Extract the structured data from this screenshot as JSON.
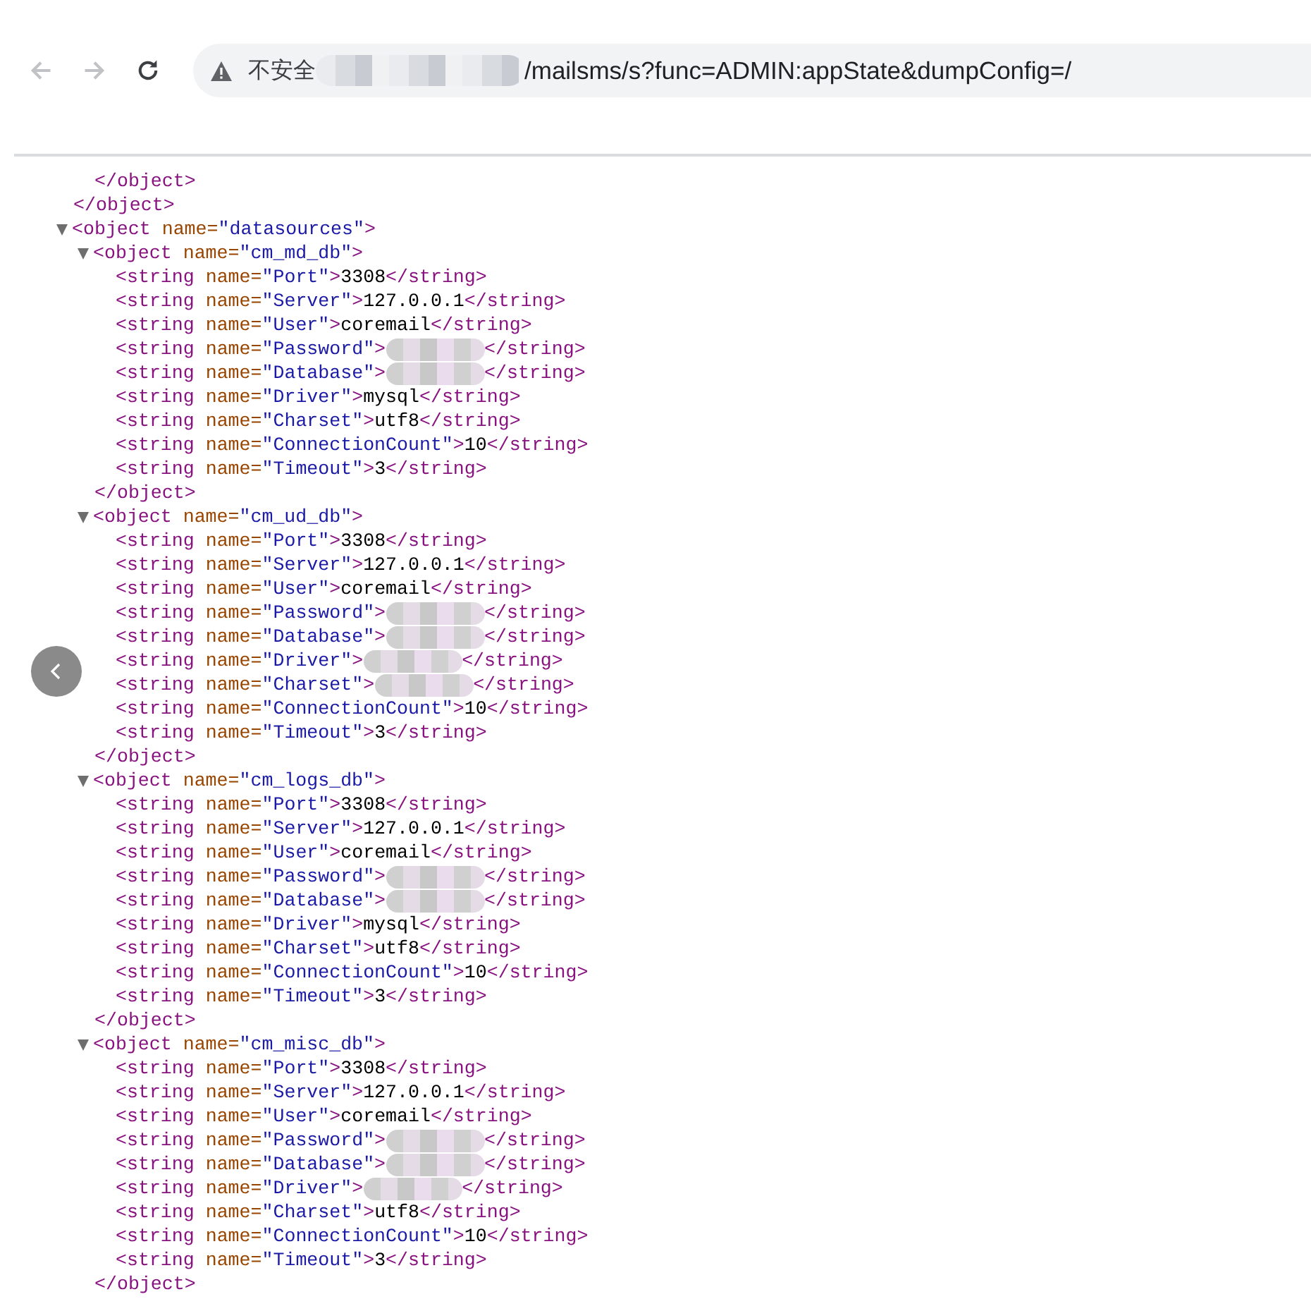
{
  "browser": {
    "nav": [
      {
        "kind": "back",
        "disabled": true
      },
      {
        "kind": "forward",
        "disabled": true
      },
      {
        "kind": "reload",
        "disabled": false
      }
    ],
    "security_label": "不安全",
    "url_parts": [
      {
        "kind": "redacted"
      },
      {
        "kind": "text",
        "text": "/mailsms/s?func=ADMIN:appState&dumpConfig=/"
      }
    ]
  },
  "xml": [
    {
      "kind": "tail",
      "close": "</object>",
      "children": [
        {
          "kind": "tail",
          "close": "</object>"
        }
      ]
    },
    {
      "kind": "element",
      "expanded": true,
      "open": "<object name=\"datasources\">",
      "children": [
        {
          "kind": "element",
          "expanded": true,
          "open": "<object name=\"cm_md_db\">",
          "close": "</object>",
          "children": [
            {
              "kind": "leaf",
              "open": "<string name=\"Port\">",
              "value": "3308",
              "close": "</string>",
              "redacted": false
            },
            {
              "kind": "leaf",
              "open": "<string name=\"Server\">",
              "value": "127.0.0.1",
              "close": "</string>",
              "redacted": false
            },
            {
              "kind": "leaf",
              "open": "<string name=\"User\">",
              "value": "coremail",
              "close": "</string>",
              "redacted": false
            },
            {
              "kind": "leaf",
              "open": "<string name=\"Password\">",
              "close": "</string>",
              "redacted": true
            },
            {
              "kind": "leaf",
              "open": "<string name=\"Database\">",
              "close": "</string>",
              "redacted": true
            },
            {
              "kind": "leaf",
              "open": "<string name=\"Driver\">",
              "value": "mysql",
              "close": "</string>",
              "redacted": false
            },
            {
              "kind": "leaf",
              "open": "<string name=\"Charset\">",
              "value": "utf8",
              "close": "</string>",
              "redacted": false
            },
            {
              "kind": "leaf",
              "open": "<string name=\"ConnectionCount\">",
              "value": "10",
              "close": "</string>",
              "redacted": false
            },
            {
              "kind": "leaf",
              "open": "<string name=\"Timeout\">",
              "value": "3",
              "close": "</string>",
              "redacted": false
            }
          ]
        },
        {
          "kind": "element",
          "expanded": true,
          "open": "<object name=\"cm_ud_db\">",
          "close": "</object>",
          "children": [
            {
              "kind": "leaf",
              "open": "<string name=\"Port\">",
              "value": "3308",
              "close": "</string>",
              "redacted": false
            },
            {
              "kind": "leaf",
              "open": "<string name=\"Server\">",
              "value": "127.0.0.1",
              "close": "</string>",
              "redacted": false
            },
            {
              "kind": "leaf",
              "open": "<string name=\"User\">",
              "value": "coremail",
              "close": "</string>",
              "redacted": false
            },
            {
              "kind": "leaf",
              "open": "<string name=\"Password\">",
              "close": "</string>",
              "redacted": true
            },
            {
              "kind": "leaf",
              "open": "<string name=\"Database\">",
              "close": "</string>",
              "redacted": true
            },
            {
              "kind": "leaf",
              "open": "<string name=\"Driver\">",
              "close": "</string>",
              "redacted": true
            },
            {
              "kind": "leaf",
              "open": "<string name=\"Charset\">",
              "close": "</string>",
              "redacted": true
            },
            {
              "kind": "leaf",
              "open": "<string name=\"ConnectionCount\">",
              "value": "10",
              "close": "</string>",
              "redacted": false
            },
            {
              "kind": "leaf",
              "open": "<string name=\"Timeout\">",
              "value": "3",
              "close": "</string>",
              "redacted": false
            }
          ]
        },
        {
          "kind": "element",
          "expanded": true,
          "open": "<object name=\"cm_logs_db\">",
          "close": "</object>",
          "children": [
            {
              "kind": "leaf",
              "open": "<string name=\"Port\">",
              "value": "3308",
              "close": "</string>",
              "redacted": false
            },
            {
              "kind": "leaf",
              "open": "<string name=\"Server\">",
              "value": "127.0.0.1",
              "close": "</string>",
              "redacted": false
            },
            {
              "kind": "leaf",
              "open": "<string name=\"User\">",
              "value": "coremail",
              "close": "</string>",
              "redacted": false
            },
            {
              "kind": "leaf",
              "open": "<string name=\"Password\">",
              "close": "</string>",
              "redacted": true
            },
            {
              "kind": "leaf",
              "open": "<string name=\"Database\">",
              "close": "</string>",
              "redacted": true
            },
            {
              "kind": "leaf",
              "open": "<string name=\"Driver\">",
              "value": "mysql",
              "close": "</string>",
              "redacted": false
            },
            {
              "kind": "leaf",
              "open": "<string name=\"Charset\">",
              "value": "utf8",
              "close": "</string>",
              "redacted": false
            },
            {
              "kind": "leaf",
              "open": "<string name=\"ConnectionCount\">",
              "value": "10",
              "close": "</string>",
              "redacted": false
            },
            {
              "kind": "leaf",
              "open": "<string name=\"Timeout\">",
              "value": "3",
              "close": "</string>",
              "redacted": false
            }
          ]
        },
        {
          "kind": "element",
          "expanded": true,
          "open": "<object name=\"cm_misc_db\">",
          "close": "</object>",
          "children": [
            {
              "kind": "leaf",
              "open": "<string name=\"Port\">",
              "value": "3308",
              "close": "</string>",
              "redacted": false
            },
            {
              "kind": "leaf",
              "open": "<string name=\"Server\">",
              "value": "127.0.0.1",
              "close": "</string>",
              "redacted": false
            },
            {
              "kind": "leaf",
              "open": "<string name=\"User\">",
              "value": "coremail",
              "close": "</string>",
              "redacted": false
            },
            {
              "kind": "leaf",
              "open": "<string name=\"Password\">",
              "close": "</string>",
              "redacted": true
            },
            {
              "kind": "leaf",
              "open": "<string name=\"Database\">",
              "close": "</string>",
              "redacted": true
            },
            {
              "kind": "leaf",
              "open": "<string name=\"Driver\">",
              "close": "</string>",
              "redacted": true
            },
            {
              "kind": "leaf",
              "open": "<string name=\"Charset\">",
              "value": "utf8",
              "close": "</string>",
              "redacted": false
            },
            {
              "kind": "leaf",
              "open": "<string name=\"ConnectionCount\">",
              "value": "10",
              "close": "</string>",
              "redacted": false
            },
            {
              "kind": "leaf",
              "open": "<string name=\"Timeout\">",
              "value": "3",
              "close": "</string>",
              "redacted": false
            }
          ]
        }
      ]
    }
  ],
  "side_back_button": {
    "shown": true
  }
}
